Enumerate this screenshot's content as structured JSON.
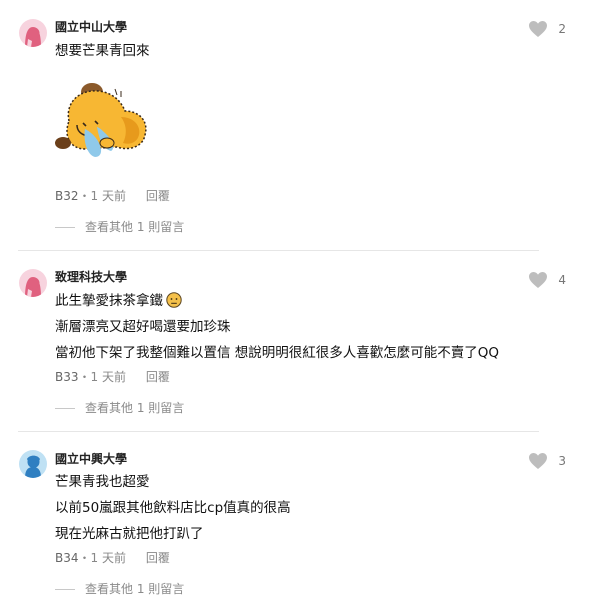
{
  "comments": [
    {
      "school": "國立中山大學",
      "lines": [
        "想要芒果青回來"
      ],
      "floor": "B32",
      "time": "1 天前",
      "reply_label": "回覆",
      "likes": "2",
      "more_replies": "查看其他 1 則留言",
      "avatar_color": "#f7d3de",
      "avatar_icon": "girl-avatar-icon"
    },
    {
      "school": "致理科技大學",
      "lines": [
        "此生摯愛抹茶拿鐵",
        "漸層漂亮又超好喝還要加珍珠",
        "當初他下架了我整個難以置信 想說明明很紅很多人喜歡怎麼可能不賣了QQ"
      ],
      "floor": "B33",
      "time": "1 天前",
      "reply_label": "回覆",
      "likes": "4",
      "more_replies": "查看其他 1 則留言",
      "avatar_color": "#f7d3de",
      "avatar_icon": "girl-avatar-icon"
    },
    {
      "school": "國立中興大學",
      "lines": [
        "芒果青我也超愛",
        "以前50嵐跟其他飲料店比cp值真的很高",
        "現在光麻古就把他打趴了"
      ],
      "floor": "B34",
      "time": "1 天前",
      "reply_label": "回覆",
      "likes": "3",
      "more_replies": "查看其他 1 則留言",
      "avatar_color": "#bfe1f4",
      "avatar_icon": "boy-avatar-icon"
    }
  ],
  "meta_separator": "・"
}
